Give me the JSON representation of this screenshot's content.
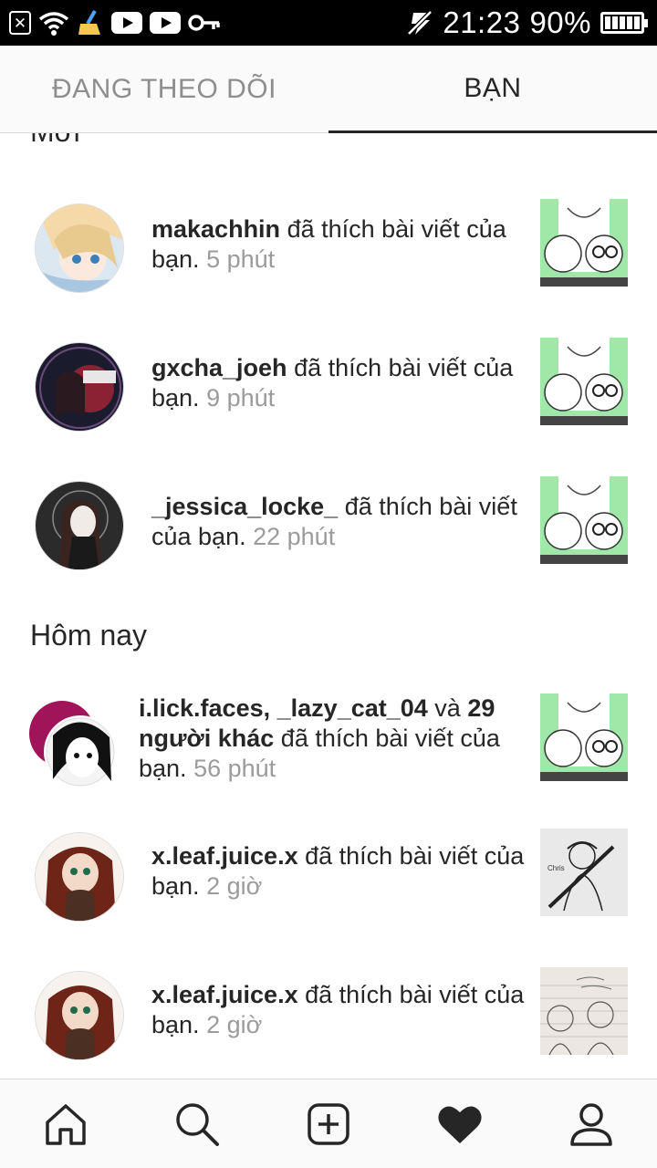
{
  "status_bar": {
    "time": "21:23",
    "battery": "90%",
    "left_icons": [
      "close-notification-icon",
      "wifi-icon",
      "cleaner-icon",
      "youtube-icon",
      "youtube-icon",
      "key-icon"
    ],
    "right_icons": [
      "mute-icon",
      "battery-icon"
    ]
  },
  "tabs": [
    {
      "label": "ĐANG THEO DÕI",
      "active": false
    },
    {
      "label": "BẠN",
      "active": true
    }
  ],
  "sections": {
    "new": "Mới",
    "today": "Hôm nay"
  },
  "notifications": [
    {
      "user": "makachhin",
      "action": "đã thích bài viết của bạn.",
      "time": "5 phút",
      "avatar": "makachhin-avatar",
      "thumb": "post-thumbnail"
    },
    {
      "user": "gxcha_joeh",
      "action": "đã thích bài viết của bạn.",
      "time": "9 phút",
      "avatar": "gxcha_joeh-avatar",
      "thumb": "post-thumbnail"
    },
    {
      "user": "_jessica_locke_",
      "action": "đã thích bài viết của bạn.",
      "time": "22 phút",
      "avatar": "jessica_locke-avatar",
      "thumb": "post-thumbnail"
    },
    {
      "user1": "i.lick.faces",
      "sep": ",",
      "user2": "_lazy_cat_04",
      "joiner": "và",
      "others": "29 người khác",
      "action": "đã thích bài viết của bạn.",
      "time": "56 phút",
      "avatar": "group-avatar",
      "thumb": "post-thumbnail"
    },
    {
      "user": "x.leaf.juice.x",
      "action": "đã thích bài viết của bạn.",
      "time": "2 giờ",
      "avatar": "x_leaf_juice_x-avatar",
      "thumb": "sketch-thumbnail"
    },
    {
      "user": "x.leaf.juice.x",
      "action": "đã thích bài viết của bạn.",
      "time": "2 giờ",
      "avatar": "x_leaf_juice_x-avatar",
      "thumb": "notebook-thumbnail"
    }
  ],
  "bottom_nav": [
    "home-icon",
    "search-icon",
    "new-post-icon",
    "activity-heart-icon",
    "profile-icon"
  ],
  "colors": {
    "status_bar": "#000000",
    "text": "#262626",
    "secondary_text": "#9b9b9b",
    "thumb_green": "#9fe8a8"
  }
}
